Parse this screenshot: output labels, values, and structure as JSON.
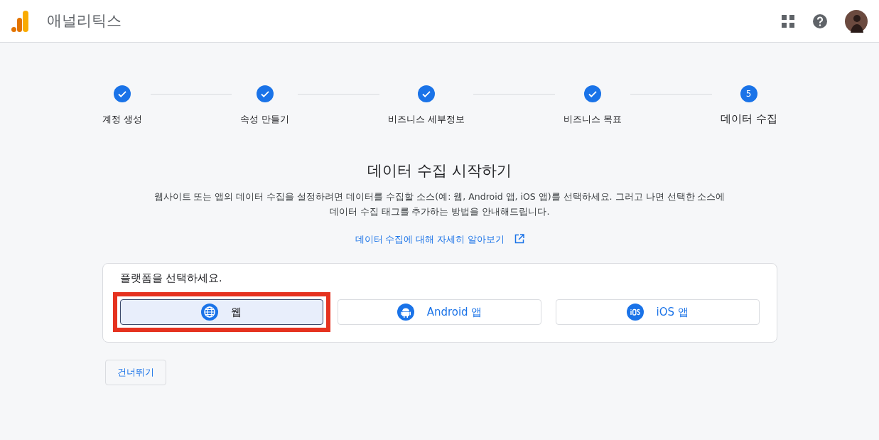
{
  "header": {
    "title": "애널리틱스"
  },
  "steps": [
    {
      "label": "계정 생성",
      "done": true,
      "current": false
    },
    {
      "label": "속성 만들기",
      "done": true,
      "current": false
    },
    {
      "label": "비즈니스 세부정보",
      "done": true,
      "current": false
    },
    {
      "label": "비즈니스 목표",
      "done": true,
      "current": false
    },
    {
      "label": "데이터 수집",
      "done": false,
      "number": "5",
      "current": true
    }
  ],
  "heading": "데이터 수집 시작하기",
  "description": "웹사이트 또는 앱의 데이터 수집을 설정하려면 데이터를 수집할 소스(예: 웹, Android 앱, iOS 앱)를 선택하세요. 그러고 나면 선택한 소스에 데이터 수집 태그를 추가하는 방법을 안내해드립니다.",
  "learn_more_link": "데이터 수집에 대해 자세히 알아보기",
  "platform_card": {
    "prompt": "플랫폼을 선택하세요.",
    "options": [
      {
        "kind": "web",
        "label": "웹",
        "selected": true,
        "highlighted": true
      },
      {
        "kind": "android",
        "label": "Android 앱",
        "selected": false,
        "highlighted": false
      },
      {
        "kind": "ios",
        "label": "iOS 앱",
        "selected": false,
        "highlighted": false
      }
    ]
  },
  "skip_button": "건너뛰기"
}
